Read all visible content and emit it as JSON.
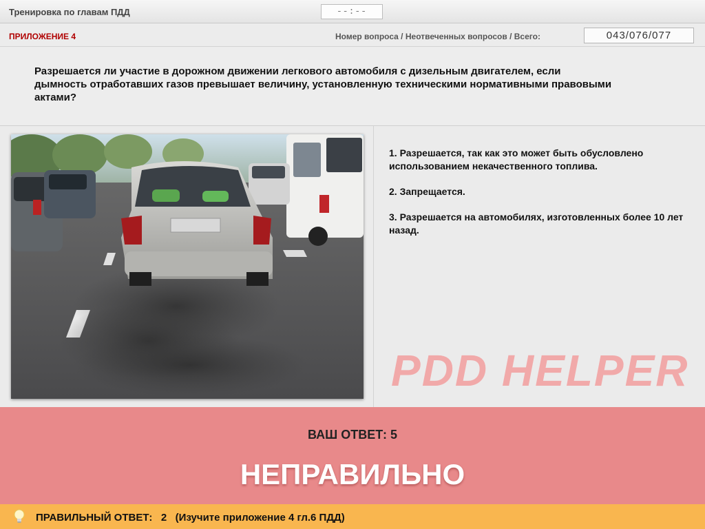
{
  "header": {
    "title": "Тренировка по главам ПДД",
    "timer": "--:--"
  },
  "info": {
    "appendix": "ПРИЛОЖЕНИЕ 4",
    "counter_label": "Номер вопроса / Неотвеченных вопросов / Всего:",
    "counter_value": "043/076/077"
  },
  "question": {
    "text": "Разрешается ли участие в дорожном движении легкового автомобиля с дизельным двигателем, если дымность отработавших газов превышает величину, установленную техническими нормативными правовыми актами?"
  },
  "answers": [
    {
      "label": "1.  Разрешается, так как это может быть обусловлено использованием некачественного топлива."
    },
    {
      "label": "2.  Запрещается."
    },
    {
      "label": "3.  Разрешается на автомобилях, изготовленных более 10 лет назад."
    }
  ],
  "watermark": "PDD HELPER",
  "result": {
    "your_answer": "ВАШ  ОТВЕТ:   5",
    "verdict": "НЕПРАВИЛЬНО"
  },
  "correct": {
    "text": "ПРАВИЛЬНЫЙ ОТВЕТ:   2   (Изучите приложение 4 гл.6 ПДД)"
  },
  "colors": {
    "result_bg": "#e8898a",
    "correct_bg": "#f9b64f",
    "appendix": "#b00000"
  },
  "icons": {
    "tip": "lightbulb-icon"
  }
}
